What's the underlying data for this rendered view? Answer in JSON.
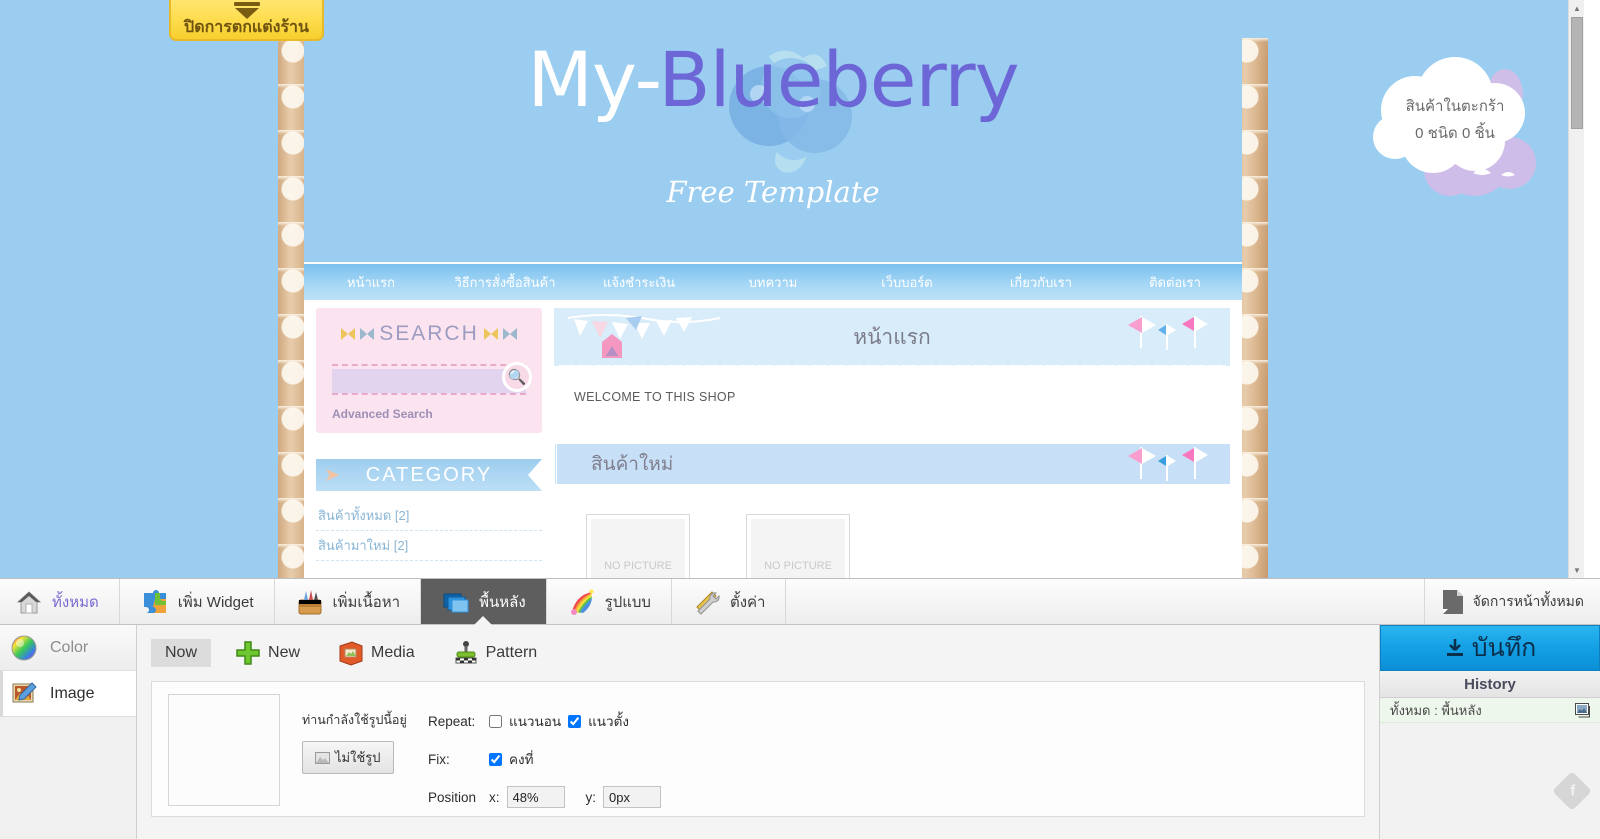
{
  "close_decor_button": {
    "label": "ปิดการตกแต่งร้าน",
    "icon": "triangle-down-icon"
  },
  "site": {
    "logo": {
      "part1": "My-",
      "part2": "Blueberry",
      "subtitle": "Free Template"
    },
    "nav": [
      {
        "label": "หน้าแรก"
      },
      {
        "label": "วิธีการสั่งซื้อสินค้า"
      },
      {
        "label": "แจ้งชำระเงิน"
      },
      {
        "label": "บทความ"
      },
      {
        "label": "เว็บบอร์ด"
      },
      {
        "label": "เกี่ยวกับเรา"
      },
      {
        "label": "ติดต่อเรา"
      }
    ],
    "search": {
      "title": "SEARCH",
      "value": "",
      "placeholder": "",
      "advanced": "Advanced Search",
      "icon": "magnifier-icon"
    },
    "category": {
      "title": "CATEGORY",
      "items": [
        {
          "label": "สินค้าทั้งหมด [2]"
        },
        {
          "label": "สินค้ามาใหม่ [2]"
        }
      ]
    },
    "page": {
      "title": "หน้าแรก",
      "welcome": "WELCOME TO THIS SHOP"
    },
    "new_products": {
      "title": "สินค้าใหม่",
      "thumbs": [
        {
          "label": "NO PICTURE"
        },
        {
          "label": "NO PICTURE"
        }
      ]
    },
    "cart": {
      "line1": "สินค้าในตะกร้า",
      "line2": "0 ชนิด 0 ชิ้น"
    }
  },
  "toolbar": {
    "items": [
      {
        "label": "ทั้งหมด",
        "icon": "home-icon",
        "active": false
      },
      {
        "label": "เพิ่ม Widget",
        "icon": "puzzle-icon",
        "active": false
      },
      {
        "label": "เพิ่มเนื้อหา",
        "icon": "toolbox-icon",
        "active": false
      },
      {
        "label": "พื้นหลัง",
        "icon": "layers-icon",
        "active": true
      },
      {
        "label": "รูปแบบ",
        "icon": "palette-icon",
        "active": false
      },
      {
        "label": "ตั้งค่า",
        "icon": "tools-icon",
        "active": false
      }
    ],
    "manage_pages": {
      "label": "จัดการหน้าทั้งหมด",
      "icon": "page-icon"
    }
  },
  "side_nav": {
    "items": [
      {
        "label": "Color",
        "icon": "color-wheel-icon",
        "selected": false
      },
      {
        "label": "Image",
        "icon": "image-edit-icon",
        "selected": true
      }
    ]
  },
  "panel": {
    "tabs": [
      {
        "label": "Now",
        "icon": "none-icon",
        "selected": true
      },
      {
        "label": "New",
        "icon": "plus-icon",
        "selected": false
      },
      {
        "label": "Media",
        "icon": "book-icon",
        "selected": false
      },
      {
        "label": "Pattern",
        "icon": "stamp-icon",
        "selected": false
      }
    ],
    "current_image_label": "ท่านกำลังใช้รูปนี้อยู่",
    "no_image_button": "ไม่ใช้รูป",
    "repeat_label": "Repeat:",
    "repeat_horizontal": {
      "label": "แนวนอน",
      "checked": false
    },
    "repeat_vertical": {
      "label": "แนวตั้ง",
      "checked": true
    },
    "fix_label": "Fix:",
    "fix_option": {
      "label": "คงที่",
      "checked": true
    },
    "position_label": "Position",
    "position_x_label": "x:",
    "position_x_value": "48%",
    "position_y_label": "y:",
    "position_y_value": "0px"
  },
  "right_panel": {
    "save_button": {
      "label": "บันทึก",
      "icon": "download-icon"
    },
    "history_title": "History",
    "history_items": [
      {
        "label": "ทั้งหมด : พื้นหลัง",
        "icon": "image-icon"
      }
    ]
  },
  "colors": {
    "site_bg": "#9acdf0",
    "logo_accent": "#6d66d6",
    "save_blue": "#13a0e4",
    "yellow_button": "#fedd4f",
    "search_pink": "#fbe4ef",
    "active_tab": "#5e5e5e"
  }
}
